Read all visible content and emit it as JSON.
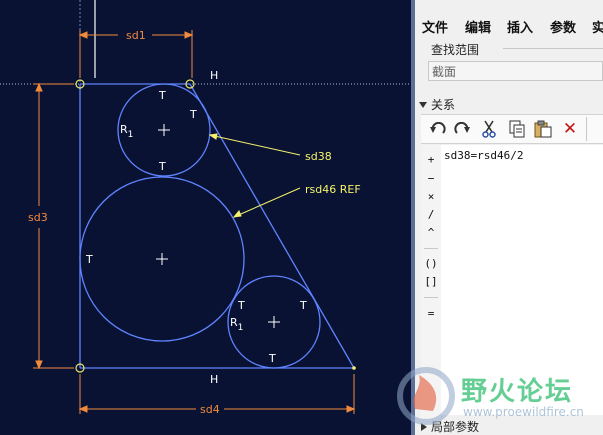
{
  "sketch": {
    "dimensions": {
      "sd1": "sd1",
      "sd3": "sd3",
      "sd4": "sd4"
    },
    "annotations": {
      "sd38": "sd38",
      "rsd46": "rsd46 REF"
    },
    "constraints": {
      "H": "H",
      "T": "T",
      "R1": "R"
    }
  },
  "panel": {
    "menu": [
      "文件",
      "编辑",
      "插入",
      "参数",
      "实"
    ],
    "lookup_title": "查找范围",
    "lookup_value": "截面",
    "relations_label": "关系",
    "operators": [
      "+",
      "−",
      "×",
      "/",
      "^",
      "()",
      "[]",
      "="
    ],
    "relation_text": "sd38=rsd46/2",
    "local_params_label": "局部参数"
  },
  "watermark": {
    "text": "野火论坛",
    "url": "www.proewildfire.cn"
  },
  "colors": {
    "sketch_bg": "#0a1233",
    "geometry": "#5f84ff",
    "dimension": "#f08a3c",
    "annotation": "#f5f26b"
  }
}
